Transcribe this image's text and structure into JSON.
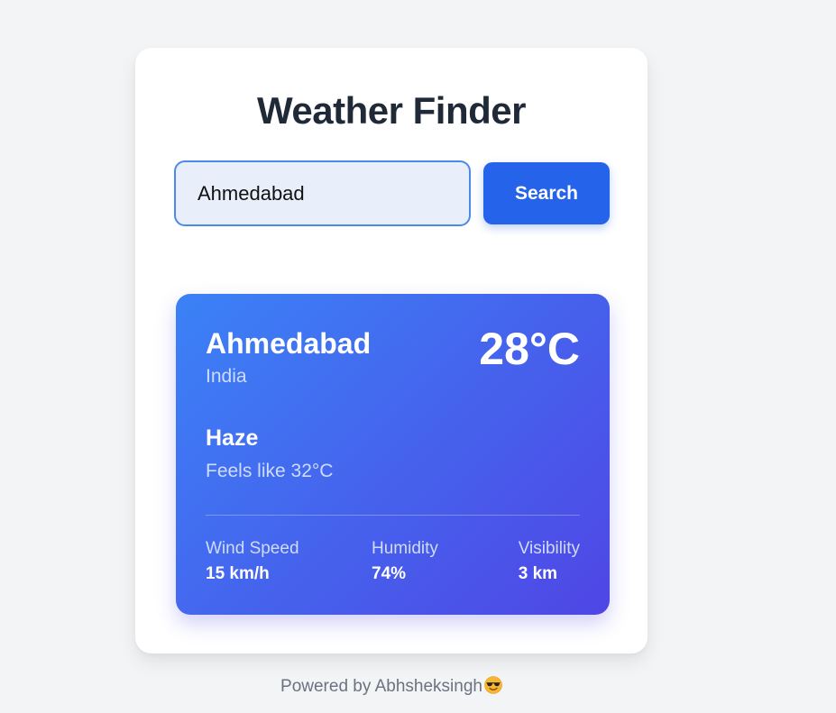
{
  "app": {
    "title": "Weather Finder"
  },
  "search": {
    "value": "Ahmedabad",
    "button_label": "Search"
  },
  "weather": {
    "city": "Ahmedabad",
    "country": "India",
    "temperature": "28°C",
    "condition": "Haze",
    "feels_like": "Feels like 32°C",
    "stats": [
      {
        "label": "Wind Speed",
        "value": "15 km/h"
      },
      {
        "label": "Humidity",
        "value": "74%"
      },
      {
        "label": "Visibility",
        "value": "3 km"
      }
    ]
  },
  "footer": {
    "text": "Powered by Abhsheksingh",
    "emoji_icon": "smiling-face-with-sunglasses-icon"
  },
  "colors": {
    "page_background": "#f3f4f6",
    "accent": "#2563eb",
    "gradient_start": "#3b82f6",
    "gradient_end": "#4f46e5",
    "title_text": "#1f2937"
  }
}
